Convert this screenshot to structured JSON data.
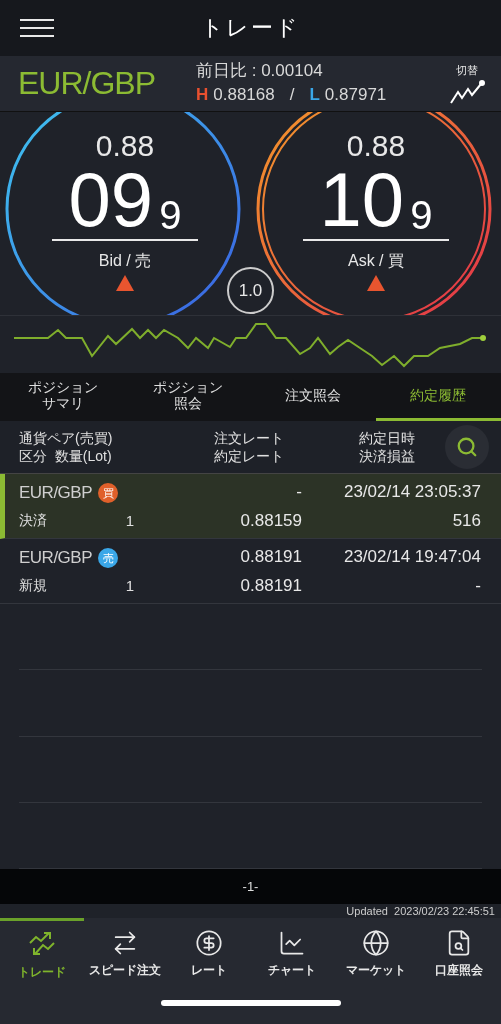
{
  "header": {
    "title": "トレード"
  },
  "quote": {
    "pair": "EUR/GBP",
    "change": "前日比 : 0.00104",
    "high_mark": "H",
    "high": "0.88168",
    "separator": "/",
    "low_mark": "L",
    "low": "0.87971",
    "switch_label": "切替"
  },
  "prices": [
    {
      "kind": "bid",
      "prefix": "0.88",
      "big": "09",
      "small": "9",
      "label": "Bid / 売",
      "rising": true
    },
    {
      "kind": "ask",
      "prefix": "0.88",
      "big": "10",
      "small": "9",
      "label": "Ask / 買",
      "rising": true
    }
  ],
  "lot": "1.0",
  "tabs": [
    {
      "lines": [
        "ポジション",
        "サマリ"
      ],
      "selected": false
    },
    {
      "lines": [
        "ポジション",
        "照会"
      ],
      "selected": false
    },
    {
      "lines": [
        "注文照会"
      ],
      "selected": false
    },
    {
      "lines": [
        "約定履歴"
      ],
      "selected": true
    }
  ],
  "columns": [
    [
      "通貨ペア(売買)",
      "区分  数量(Lot)"
    ],
    [
      "注文レート",
      "約定レート"
    ],
    [
      "約定日時",
      "決済損益"
    ]
  ],
  "rows": [
    {
      "pair": "EUR/GBP",
      "kind": "buy",
      "side_label": "買",
      "type": "決済",
      "lots": "1",
      "order_rate": "-",
      "fill_rate": "0.88159",
      "datetime": "23/02/14 23:05:37",
      "pnl": "516",
      "selected": true
    },
    {
      "pair": "EUR/GBP",
      "kind": "sell",
      "side_label": "売",
      "type": "新規",
      "lots": "1",
      "order_rate": "0.88191",
      "fill_rate": "0.88191",
      "datetime": "23/02/14 19:47:04",
      "pnl": "-",
      "selected": false
    }
  ],
  "pager": "-1-",
  "updated": "Updated  2023/02/23 22:45:51",
  "nav": [
    {
      "label": "トレード",
      "kind": "trade",
      "selected": true
    },
    {
      "label": "スピード注文",
      "kind": "speed",
      "selected": false
    },
    {
      "label": "レート",
      "kind": "rate",
      "selected": false
    },
    {
      "label": "チャート",
      "kind": "chart",
      "selected": false
    },
    {
      "label": "マーケット",
      "kind": "market",
      "selected": false
    },
    {
      "label": "口座照会",
      "kind": "account",
      "selected": false
    }
  ]
}
